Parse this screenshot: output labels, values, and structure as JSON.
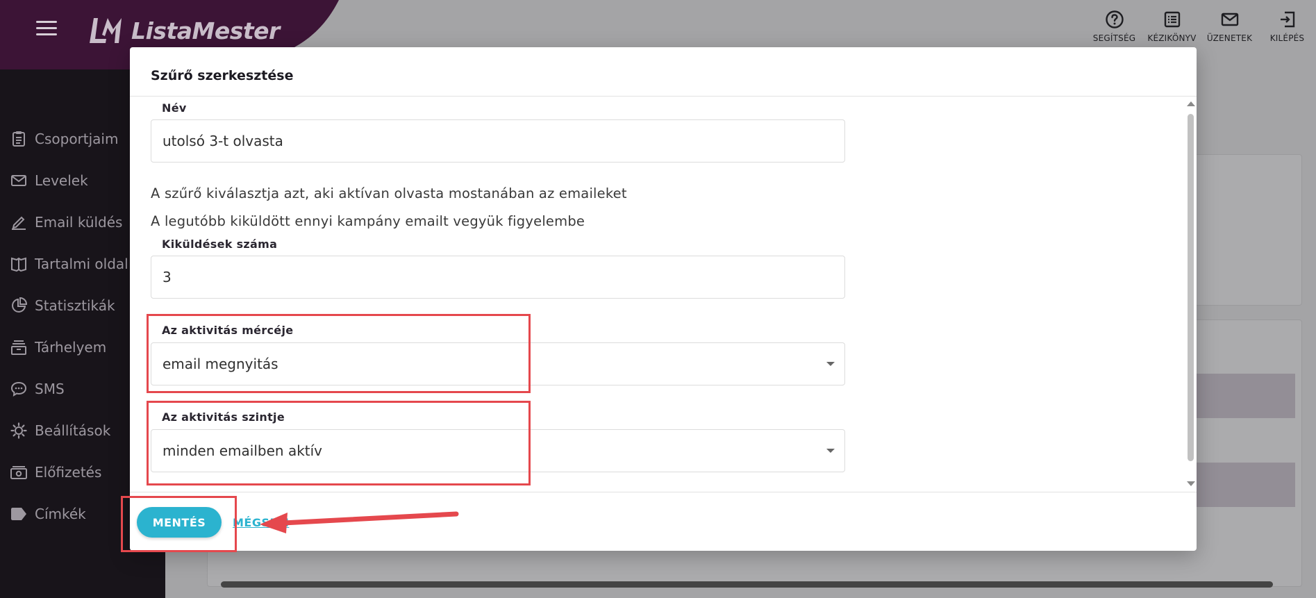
{
  "app": {
    "brand": "ListaMester",
    "colors": {
      "brand_dark": "#3c1436",
      "accent": "#2bb3cf",
      "annotation": "#e5484d"
    }
  },
  "top_actions": [
    {
      "label": "SEGÍTSÉG",
      "icon": "help-circle-icon"
    },
    {
      "label": "KÉZIKÖNYV",
      "icon": "manual-list-icon"
    },
    {
      "label": "ÜZENETEK",
      "icon": "mail-icon"
    },
    {
      "label": "KILÉPÉS",
      "icon": "logout-icon"
    }
  ],
  "sidebar": {
    "items": [
      {
        "label": "Csoportjaim",
        "icon": "clipboard-icon"
      },
      {
        "label": "Levelek",
        "icon": "envelope-icon"
      },
      {
        "label": "Email küldés",
        "icon": "pen-icon"
      },
      {
        "label": "Tartalmi oldal",
        "icon": "book-icon"
      },
      {
        "label": "Statisztikák",
        "icon": "pie-chart-icon"
      },
      {
        "label": "Tárhelyem",
        "icon": "storage-icon"
      },
      {
        "label": "SMS",
        "icon": "chat-bubble-icon"
      },
      {
        "label": "Beállítások",
        "icon": "gear-icon"
      },
      {
        "label": "Előfizetés",
        "icon": "money-icon"
      },
      {
        "label": "Címkék",
        "icon": "tag-icon"
      }
    ]
  },
  "modal": {
    "title": "Szűrő szerkesztése",
    "name_label": "Név",
    "name_value": "utolsó 3-t olvasta",
    "description_1": "A szűrő kiválasztja azt, aki aktívan olvasta mostanában az emaileket",
    "description_2": "A legutóbb kiküldött ennyi kampány emailt vegyük figyelembe",
    "count_label": "Kiküldések száma",
    "count_value": "3",
    "measure_label": "Az aktivitás mércéje",
    "measure_value": "email megnyitás",
    "level_label": "Az aktivitás szintje",
    "level_value": "minden emailben aktív",
    "save_label": "MENTÉS",
    "cancel_label": "MÉGSEM"
  }
}
